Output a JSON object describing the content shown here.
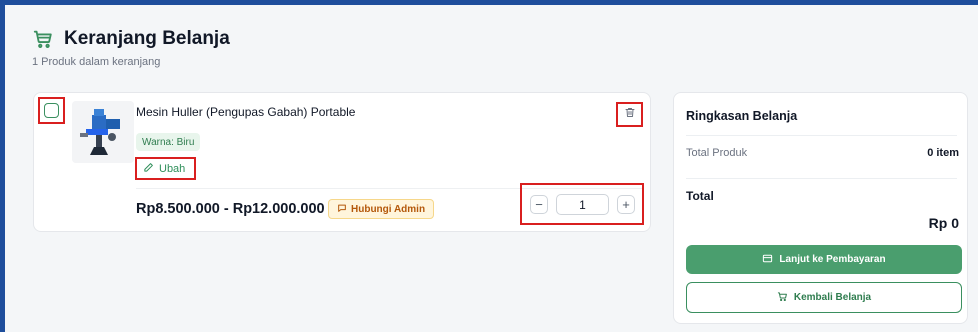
{
  "page": {
    "title": "Keranjang Belanja",
    "subtitle": "1 Produk dalam keranjang",
    "accent_color": "#3a8f5f",
    "highlight_color": "#d91f1f"
  },
  "cart_item": {
    "selected": false,
    "image_icon": "product-thumbnail",
    "name": "Mesin Huller (Pengupas Gabah) Portable",
    "variant": "Warna: Biru",
    "edit_label": "Ubah",
    "price_range": "Rp8.500.000 - Rp12.000.000",
    "contact_admin_label": "Hubungi Admin",
    "quantity": "1",
    "decrement_symbol": "−",
    "increment_symbol": "+"
  },
  "summary": {
    "title": "Ringkasan Belanja",
    "total_products_label": "Total Produk",
    "total_products_value": "0 item",
    "total_label": "Total",
    "total_value": "Rp 0",
    "checkout_label": "Lanjut ke Pembayaran",
    "back_label": "Kembali Belanja"
  }
}
